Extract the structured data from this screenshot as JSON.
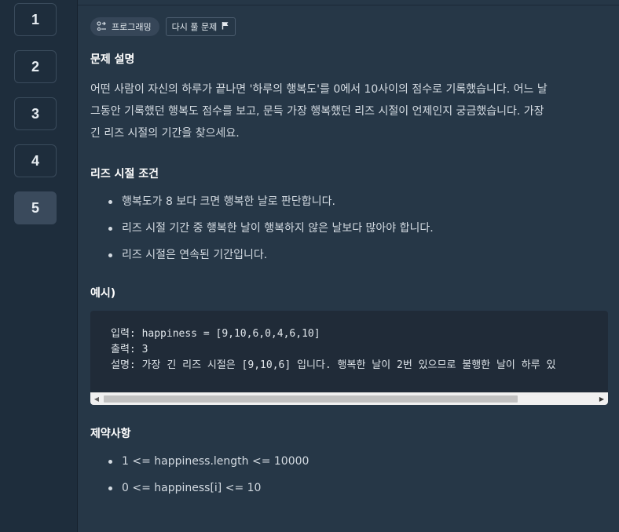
{
  "sidebar": {
    "questions": [
      {
        "label": "1",
        "active": false
      },
      {
        "label": "2",
        "active": false
      },
      {
        "label": "3",
        "active": false
      },
      {
        "label": "4",
        "active": false
      },
      {
        "label": "5",
        "active": true
      }
    ]
  },
  "tags": {
    "programming_label": "프로그래밍",
    "retry_label": "다시 풀 문제"
  },
  "problem": {
    "desc_heading": "문제 설명",
    "desc_lines": [
      "어떤 사람이 자신의 하루가 끝나면 '하루의 행복도'를 0에서 10사이의 점수로 기록했습니다. 어느 날",
      "그동안 기록했던 행복도 점수를 보고, 문득 가장 행복했던 리즈 시절이 언제인지 궁금했습니다. 가장",
      "긴 리즈 시절의 기간을 찾으세요."
    ],
    "conditions_heading": "리즈 시절 조건",
    "conditions": [
      "행복도가 8 보다 크면 행복한 날로 판단합니다.",
      "리즈 시절 기간 중 행복한 날이 행복하지 않은 날보다 많아야 합니다.",
      "리즈 시절은 연속된 기간입니다."
    ],
    "example_heading": "예시)",
    "example_code": [
      "입력: happiness = [9,10,6,0,4,6,10]",
      "출력: 3",
      "설명: 가장 긴 리즈 시절은 [9,10,6] 입니다. 행복한 날이 2번 있으므로 불행한 날이 하루 있"
    ],
    "constraints_heading": "제약사항",
    "constraints": [
      "1 <= happiness.length <= 10000",
      "0 <= happiness[i] <= 10"
    ]
  },
  "colors": {
    "background": "#263747",
    "sidebar": "#1e2d3c",
    "code_background": "#202b38",
    "active_question": "#3a4a5c"
  },
  "icons": {
    "programming": "code-branch-icon",
    "retry": "flag-icon"
  }
}
